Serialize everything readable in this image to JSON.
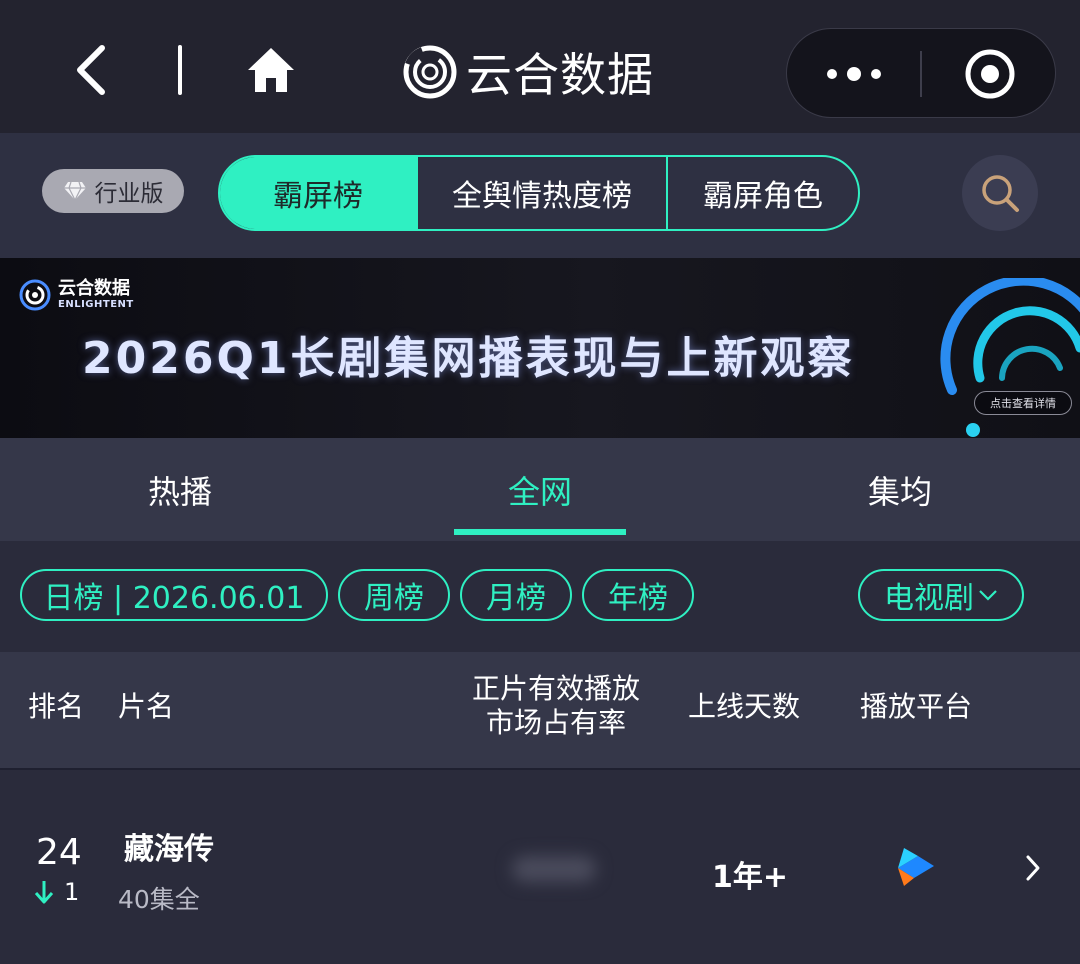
{
  "app": {
    "title": "云合数据"
  },
  "segments": {
    "edition": "行业版",
    "items": [
      "霸屏榜",
      "全舆情热度榜",
      "霸屏角色"
    ]
  },
  "banner": {
    "logo_cn": "云合数据",
    "logo_en": "ENLIGHTENT",
    "headline": "2026Q1长剧集网播表现与上新观察",
    "detail": "点击查看详情"
  },
  "tabs": [
    {
      "label": "热播"
    },
    {
      "label": "全网"
    },
    {
      "label": "集均"
    }
  ],
  "filters": {
    "daily": "日榜 | 2026.06.01",
    "weekly": "周榜",
    "monthly": "月榜",
    "yearly": "年榜",
    "category": "电视剧"
  },
  "table": {
    "headers": {
      "rank": "排名",
      "title": "片名",
      "share_line1": "正片有效播放",
      "share_line2": "市场占有率",
      "days": "上线天数",
      "platform": "播放平台"
    },
    "rows": [
      {
        "rank": "24",
        "change": "1",
        "title": "藏海传",
        "episodes": "40集全",
        "days": "1年+"
      }
    ]
  },
  "colors": {
    "accent": "#2ff0c2",
    "background": "#2a2b3b",
    "navbar": "#23232f",
    "header": "#353749"
  },
  "icons": {
    "back": "chevron-left-icon",
    "home": "home-icon",
    "more": "more-dots-icon",
    "target": "target-icon",
    "search": "search-icon",
    "platform": "play-triangle-icon",
    "arrow": "chevron-right-icon",
    "diamond": "diamond-icon",
    "down": "arrow-down-icon"
  }
}
